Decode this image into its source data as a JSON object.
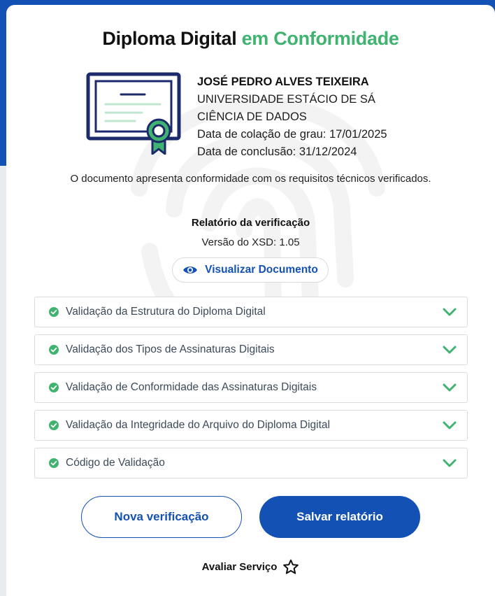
{
  "colors": {
    "brand_blue": "#1351b4",
    "success_green": "#3fb36f",
    "card_bg": "#ffffff"
  },
  "header": {
    "title_main": "Diploma Digital",
    "title_accent": "em Conformidade"
  },
  "graduate": {
    "name": "JOSÉ PEDRO ALVES TEIXEIRA",
    "university": "UNIVERSIDADE ESTÁCIO DE SÁ",
    "course": "CIÊNCIA DE DADOS",
    "graduation_date": "Data de colação de grau: 17/01/2025",
    "completion_date": "Data de conclusão: 31/12/2024"
  },
  "status_message": "O documento apresenta conformidade com os requisitos técnicos verificados.",
  "report": {
    "label": "Relatório da verificação",
    "xsd_version": "Versão do XSD: 1.05",
    "view_document": "Visualizar Documento"
  },
  "validations": [
    {
      "label": "Validação da Estrutura do Diploma Digital",
      "status": "ok"
    },
    {
      "label": "Validação dos Tipos de Assinaturas Digitais",
      "status": "ok"
    },
    {
      "label": "Validação de Conformidade das Assinaturas Digitais",
      "status": "ok"
    },
    {
      "label": "Validação da Integridade do Arquivo do Diploma Digital",
      "status": "ok"
    },
    {
      "label": "Código de Validação",
      "status": "ok"
    }
  ],
  "actions": {
    "new_verification": "Nova verificação",
    "save_report": "Salvar relatório"
  },
  "rating": {
    "label": "Avaliar Serviço"
  },
  "icons": [
    "fingerprint-watermark-icon",
    "certificate-icon",
    "eye-icon",
    "check-circle-icon",
    "chevron-down-icon",
    "star-icon"
  ]
}
